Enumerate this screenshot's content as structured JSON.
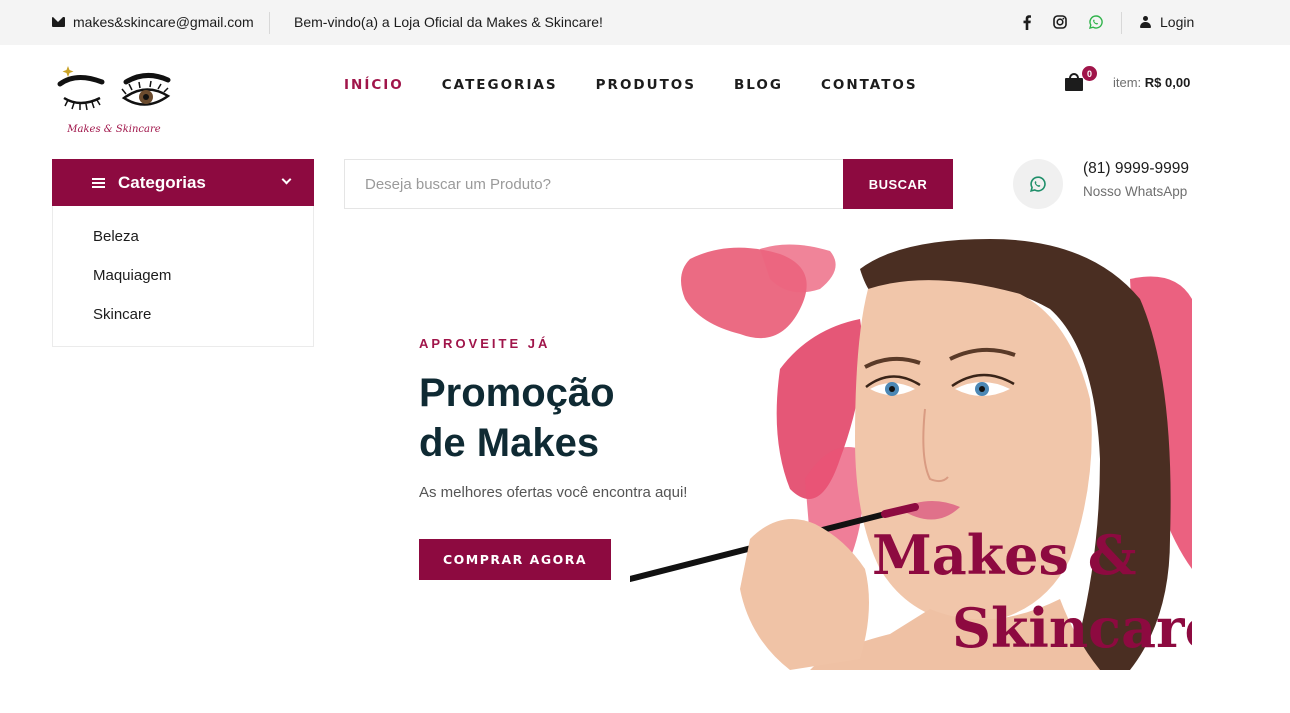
{
  "topbar": {
    "email": "makes&skincare@gmail.com",
    "welcome": "Bem-vindo(a) a Loja Oficial da Makes & Skincare!",
    "social_icons": [
      "facebook-icon",
      "instagram-icon",
      "whatsapp-icon"
    ],
    "login": "Login"
  },
  "logo": {
    "text": "Makes & Skincare"
  },
  "nav": {
    "items": [
      {
        "label": "INÍCIO",
        "active": true
      },
      {
        "label": "CATEGORIAS",
        "active": false
      },
      {
        "label": "PRODUTOS",
        "active": false
      },
      {
        "label": "BLOG",
        "active": false
      },
      {
        "label": "CONTATOS",
        "active": false
      }
    ]
  },
  "cart": {
    "count": "0",
    "label": "item:",
    "total": "R$ 0,00"
  },
  "categories": {
    "title": "Categorias",
    "items": [
      "Beleza",
      "Maquiagem",
      "Skincare"
    ]
  },
  "search": {
    "placeholder": "Deseja buscar um Produto?",
    "button": "BUSCAR"
  },
  "whatsapp": {
    "phone": "(81) 9999-9999",
    "label": "Nosso WhatsApp"
  },
  "hero": {
    "kicker": "APROVEITE JÁ",
    "title_line1": "Promoção",
    "title_line2": "de Makes",
    "subtitle": "As melhores ofertas você encontra aqui!",
    "button": "COMPRAR AGORA",
    "brand_line1": "Makes &",
    "brand_line2": "Skincare"
  },
  "colors": {
    "accent": "#8d0a40",
    "active_nav": "#a0154a",
    "title": "#0f2a33",
    "topbar_bg": "#f4f4f4"
  }
}
